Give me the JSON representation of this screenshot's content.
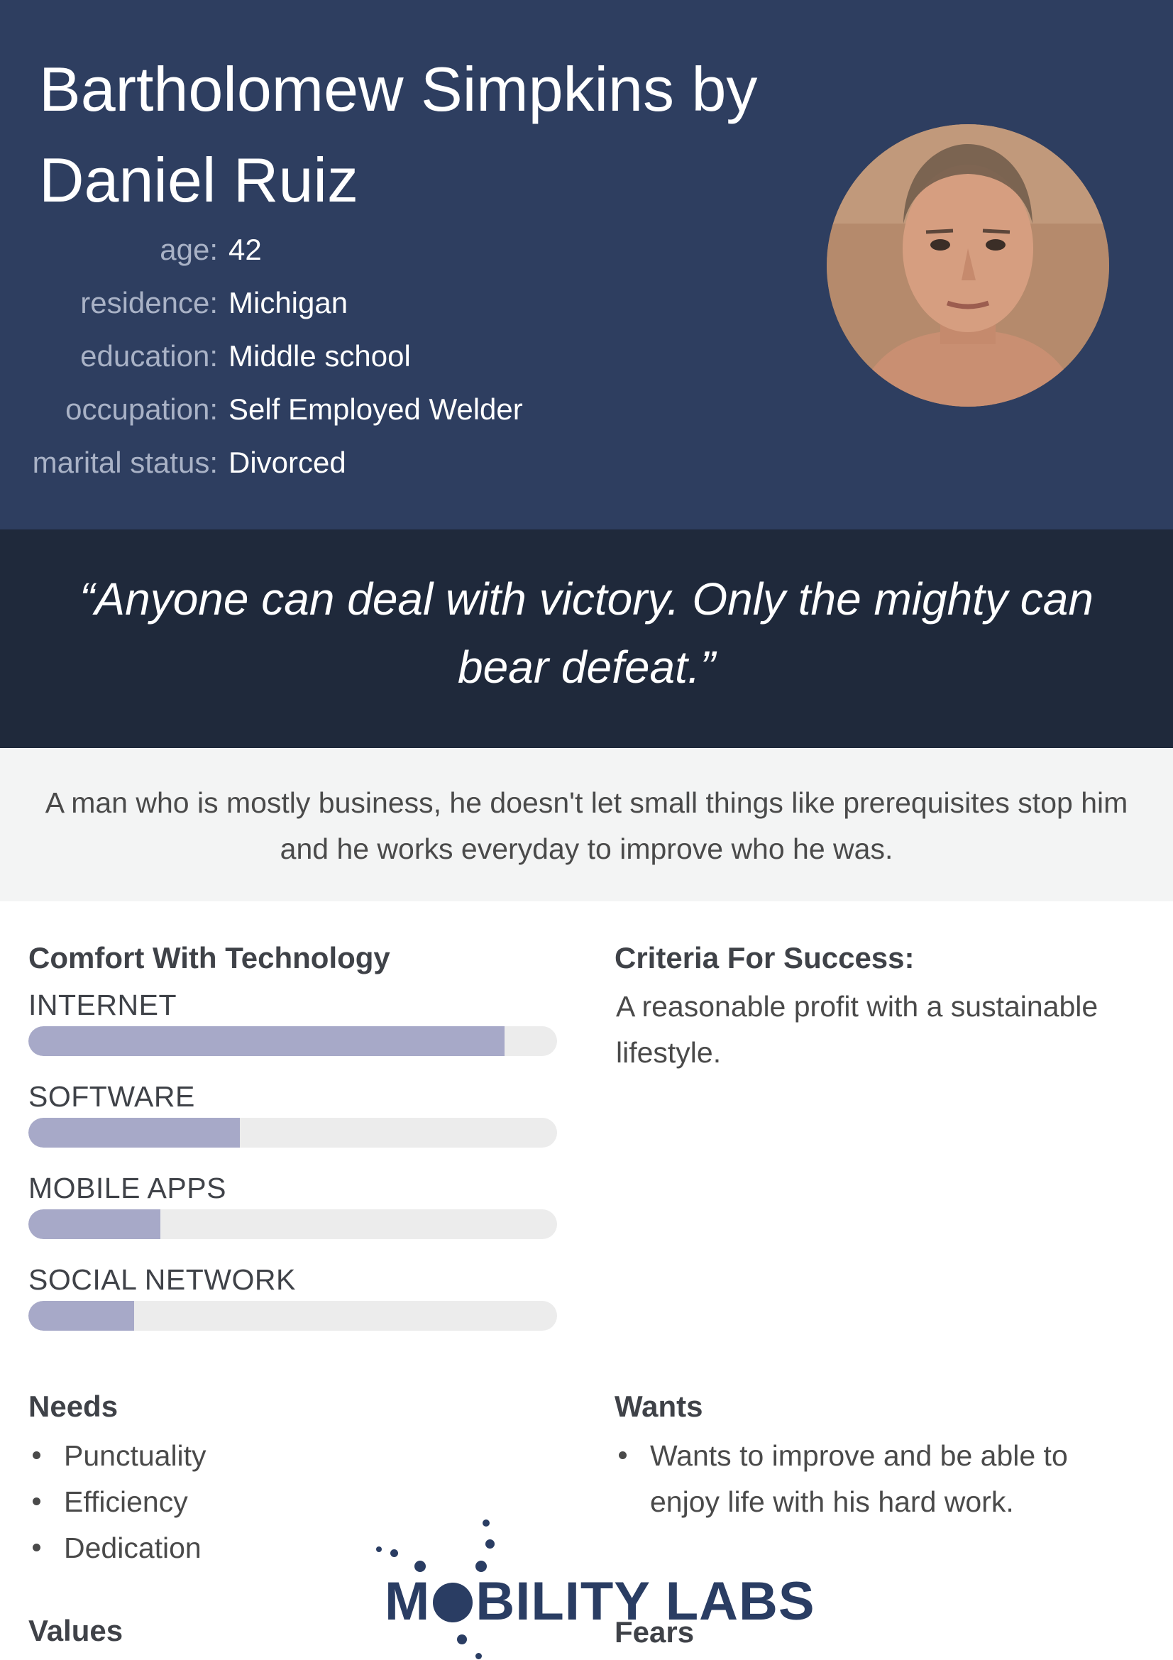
{
  "header": {
    "name": "Bartholomew Simpkins by Daniel Ruiz",
    "facts": [
      {
        "label": "age:",
        "value": "42"
      },
      {
        "label": "residence:",
        "value": "Michigan"
      },
      {
        "label": "education:",
        "value": "Middle school"
      },
      {
        "label": "occupation:",
        "value": "Self Employed Welder"
      },
      {
        "label": "marital status:",
        "value": "Divorced"
      }
    ]
  },
  "quote": "“Anyone can deal with victory. Only the mighty can bear defeat.”",
  "bio": "A man who is mostly business, he doesn't let small things like prerequisites stop him and he works everyday to improve who he was.",
  "technology": {
    "heading": "Comfort With Technology",
    "items": [
      {
        "label": "INTERNET",
        "level": 0.9
      },
      {
        "label": "SOFTWARE",
        "level": 0.4
      },
      {
        "label": "MOBILE APPS",
        "level": 0.25
      },
      {
        "label": "SOCIAL NETWORK",
        "level": 0.2
      }
    ]
  },
  "success": {
    "heading": "Criteria For Success:",
    "text": "A reasonable profit with a sustainable lifestyle."
  },
  "needs": {
    "heading": "Needs",
    "items": [
      "Punctuality",
      "Efficiency",
      "Dedication"
    ]
  },
  "wants": {
    "heading": "Wants",
    "items": [
      "Wants to improve and be able to enjoy life with his hard work."
    ]
  },
  "values": {
    "heading": "Values"
  },
  "fears": {
    "heading": "Fears"
  },
  "logo": {
    "before": "M",
    "after": "BILITY LABS"
  },
  "colors": {
    "header_bg": "#2e3e60",
    "quote_bg": "#1f293b",
    "bio_bg": "#f3f4f4",
    "bar_fill": "#a7a9c8",
    "bar_track": "#ececec",
    "logo": "#2a3d63"
  }
}
